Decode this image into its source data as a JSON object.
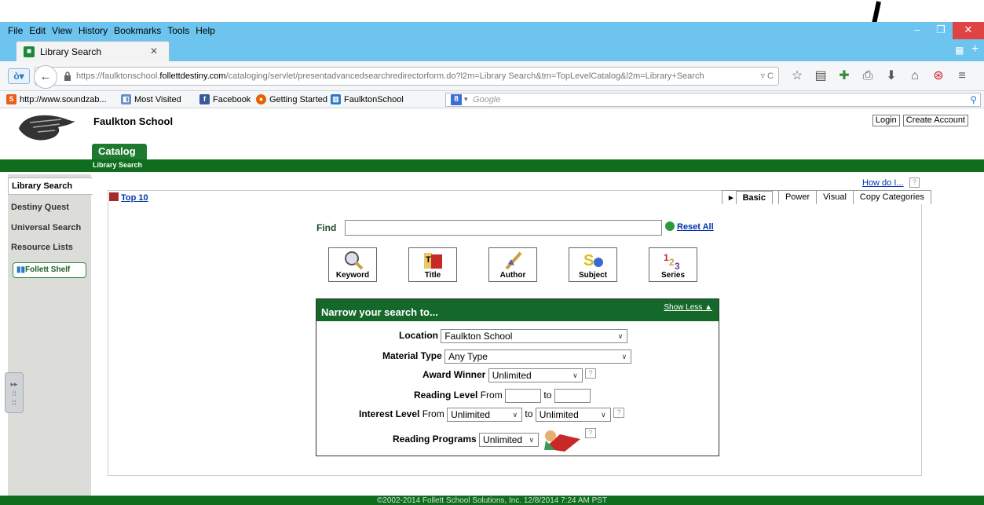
{
  "browser": {
    "menus": [
      "File",
      "Edit",
      "View",
      "History",
      "Bookmarks",
      "Tools",
      "Help"
    ],
    "tab_title": "Library Search",
    "url_prefix": "https://faulktonschool.",
    "url_domain": "follettdestiny.com",
    "url_suffix": "/cataloging/servlet/presentadvancedsearchredirectorform.do?l2m=Library Search&tm=TopLevelCatalog&l2m=Library+Search",
    "bookmarks": [
      "http://www.soundzab...",
      "Most Visited",
      "Facebook",
      "Getting Started",
      "FaulktonSchool"
    ],
    "search_placeholder": "Google"
  },
  "page": {
    "school_name": "Faulkton School",
    "login": "Login",
    "create_account": "Create Account",
    "catalog_tab": "Catalog",
    "sub_title": "Library Search",
    "footer": "©2002-2014 Follett School Solutions, Inc.    12/8/2014 7:24 AM PST"
  },
  "leftnav": {
    "items": [
      "Library Search",
      "Destiny Quest",
      "Universal Search",
      "Resource Lists"
    ],
    "follett_shelf": "Follett Shelf"
  },
  "main": {
    "how_do_i": "How do I...",
    "top10": "Top 10",
    "tabs": [
      "Basic",
      "Power",
      "Visual",
      "Copy Categories"
    ],
    "find_label": "Find",
    "find_value": "",
    "reset_all": "Reset All",
    "search_buttons": [
      "Keyword",
      "Title",
      "Author",
      "Subject",
      "Series"
    ]
  },
  "narrow": {
    "title": "Narrow your search to...",
    "show_less": "Show Less",
    "location_label": "Location",
    "location_value": "Faulkton School",
    "material_label": "Material Type",
    "material_value": "Any Type",
    "award_label": "Award Winner",
    "award_value": "Unlimited",
    "reading_level_label": "Reading Level",
    "from": "From",
    "to": "to",
    "interest_label": "Interest Level",
    "interest_from": "Unlimited",
    "interest_to": "Unlimited",
    "programs_label": "Reading Programs",
    "programs_value": "Unlimited"
  }
}
